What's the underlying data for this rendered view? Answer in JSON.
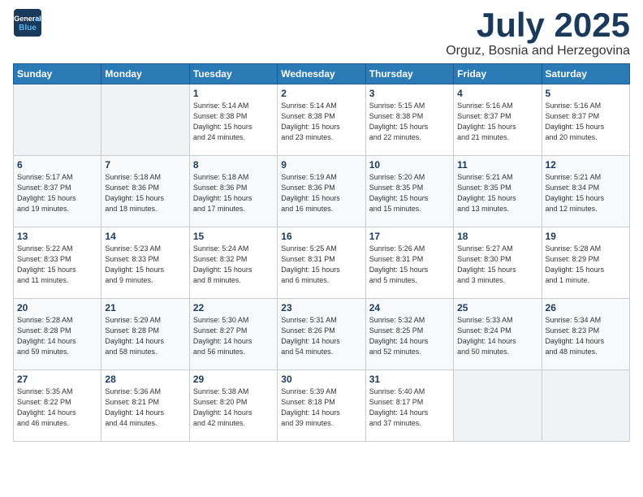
{
  "header": {
    "logo_line1": "General",
    "logo_line2": "Blue",
    "month": "July 2025",
    "location": "Orguz, Bosnia and Herzegovina"
  },
  "weekdays": [
    "Sunday",
    "Monday",
    "Tuesday",
    "Wednesday",
    "Thursday",
    "Friday",
    "Saturday"
  ],
  "weeks": [
    [
      {
        "day": "",
        "info": ""
      },
      {
        "day": "",
        "info": ""
      },
      {
        "day": "1",
        "info": "Sunrise: 5:14 AM\nSunset: 8:38 PM\nDaylight: 15 hours\nand 24 minutes."
      },
      {
        "day": "2",
        "info": "Sunrise: 5:14 AM\nSunset: 8:38 PM\nDaylight: 15 hours\nand 23 minutes."
      },
      {
        "day": "3",
        "info": "Sunrise: 5:15 AM\nSunset: 8:38 PM\nDaylight: 15 hours\nand 22 minutes."
      },
      {
        "day": "4",
        "info": "Sunrise: 5:16 AM\nSunset: 8:37 PM\nDaylight: 15 hours\nand 21 minutes."
      },
      {
        "day": "5",
        "info": "Sunrise: 5:16 AM\nSunset: 8:37 PM\nDaylight: 15 hours\nand 20 minutes."
      }
    ],
    [
      {
        "day": "6",
        "info": "Sunrise: 5:17 AM\nSunset: 8:37 PM\nDaylight: 15 hours\nand 19 minutes."
      },
      {
        "day": "7",
        "info": "Sunrise: 5:18 AM\nSunset: 8:36 PM\nDaylight: 15 hours\nand 18 minutes."
      },
      {
        "day": "8",
        "info": "Sunrise: 5:18 AM\nSunset: 8:36 PM\nDaylight: 15 hours\nand 17 minutes."
      },
      {
        "day": "9",
        "info": "Sunrise: 5:19 AM\nSunset: 8:36 PM\nDaylight: 15 hours\nand 16 minutes."
      },
      {
        "day": "10",
        "info": "Sunrise: 5:20 AM\nSunset: 8:35 PM\nDaylight: 15 hours\nand 15 minutes."
      },
      {
        "day": "11",
        "info": "Sunrise: 5:21 AM\nSunset: 8:35 PM\nDaylight: 15 hours\nand 13 minutes."
      },
      {
        "day": "12",
        "info": "Sunrise: 5:21 AM\nSunset: 8:34 PM\nDaylight: 15 hours\nand 12 minutes."
      }
    ],
    [
      {
        "day": "13",
        "info": "Sunrise: 5:22 AM\nSunset: 8:33 PM\nDaylight: 15 hours\nand 11 minutes."
      },
      {
        "day": "14",
        "info": "Sunrise: 5:23 AM\nSunset: 8:33 PM\nDaylight: 15 hours\nand 9 minutes."
      },
      {
        "day": "15",
        "info": "Sunrise: 5:24 AM\nSunset: 8:32 PM\nDaylight: 15 hours\nand 8 minutes."
      },
      {
        "day": "16",
        "info": "Sunrise: 5:25 AM\nSunset: 8:31 PM\nDaylight: 15 hours\nand 6 minutes."
      },
      {
        "day": "17",
        "info": "Sunrise: 5:26 AM\nSunset: 8:31 PM\nDaylight: 15 hours\nand 5 minutes."
      },
      {
        "day": "18",
        "info": "Sunrise: 5:27 AM\nSunset: 8:30 PM\nDaylight: 15 hours\nand 3 minutes."
      },
      {
        "day": "19",
        "info": "Sunrise: 5:28 AM\nSunset: 8:29 PM\nDaylight: 15 hours\nand 1 minute."
      }
    ],
    [
      {
        "day": "20",
        "info": "Sunrise: 5:28 AM\nSunset: 8:28 PM\nDaylight: 14 hours\nand 59 minutes."
      },
      {
        "day": "21",
        "info": "Sunrise: 5:29 AM\nSunset: 8:28 PM\nDaylight: 14 hours\nand 58 minutes."
      },
      {
        "day": "22",
        "info": "Sunrise: 5:30 AM\nSunset: 8:27 PM\nDaylight: 14 hours\nand 56 minutes."
      },
      {
        "day": "23",
        "info": "Sunrise: 5:31 AM\nSunset: 8:26 PM\nDaylight: 14 hours\nand 54 minutes."
      },
      {
        "day": "24",
        "info": "Sunrise: 5:32 AM\nSunset: 8:25 PM\nDaylight: 14 hours\nand 52 minutes."
      },
      {
        "day": "25",
        "info": "Sunrise: 5:33 AM\nSunset: 8:24 PM\nDaylight: 14 hours\nand 50 minutes."
      },
      {
        "day": "26",
        "info": "Sunrise: 5:34 AM\nSunset: 8:23 PM\nDaylight: 14 hours\nand 48 minutes."
      }
    ],
    [
      {
        "day": "27",
        "info": "Sunrise: 5:35 AM\nSunset: 8:22 PM\nDaylight: 14 hours\nand 46 minutes."
      },
      {
        "day": "28",
        "info": "Sunrise: 5:36 AM\nSunset: 8:21 PM\nDaylight: 14 hours\nand 44 minutes."
      },
      {
        "day": "29",
        "info": "Sunrise: 5:38 AM\nSunset: 8:20 PM\nDaylight: 14 hours\nand 42 minutes."
      },
      {
        "day": "30",
        "info": "Sunrise: 5:39 AM\nSunset: 8:18 PM\nDaylight: 14 hours\nand 39 minutes."
      },
      {
        "day": "31",
        "info": "Sunrise: 5:40 AM\nSunset: 8:17 PM\nDaylight: 14 hours\nand 37 minutes."
      },
      {
        "day": "",
        "info": ""
      },
      {
        "day": "",
        "info": ""
      }
    ]
  ]
}
